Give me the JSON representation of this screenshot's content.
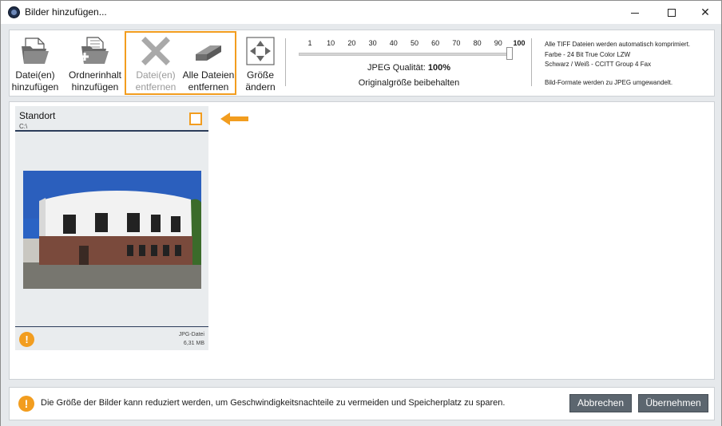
{
  "window": {
    "title": "Bilder hinzufügen...",
    "minimize": "minimize",
    "maximize": "maximize",
    "close": "✕"
  },
  "toolbar": {
    "add_files": "Datei(en) hinzufügen",
    "add_folder": "Ordnerinhalt hinzufügen",
    "remove_files": "Datei(en) entfernen",
    "remove_all": "Alle Dateien entfernen",
    "resize": "Größe ändern"
  },
  "quality": {
    "ticks": [
      "1",
      "10",
      "20",
      "30",
      "40",
      "50",
      "60",
      "70",
      "80",
      "90",
      "100"
    ],
    "value": 100,
    "label": "JPEG Qualität:",
    "value_text": "100%",
    "size_text": "Originalgröße beibehalten"
  },
  "info": {
    "line1": "Alle TIFF Dateien werden automatisch komprimiert.",
    "line2": "Farbe - 24 Bit True Color LZW",
    "line3": "Schwarz / Weiß - CCITT Group 4 Fax",
    "line4": "Bild-Formate werden zu JPEG umgewandelt."
  },
  "card": {
    "name": "Standort",
    "path": "C:\\",
    "type": "JPG-Datei",
    "size": "6,31 MB",
    "warn": "!"
  },
  "footer": {
    "warn": "!",
    "message": "Die Größe der Bilder kann reduziert werden, um Geschwindigkeitsnachteile zu vermeiden und Speicherplatz zu sparen.",
    "cancel": "Abbrechen",
    "apply": "Übernehmen"
  },
  "colors": {
    "accent": "#f29d1f",
    "button": "#5c666f",
    "card_line": "#2b3c5a"
  }
}
